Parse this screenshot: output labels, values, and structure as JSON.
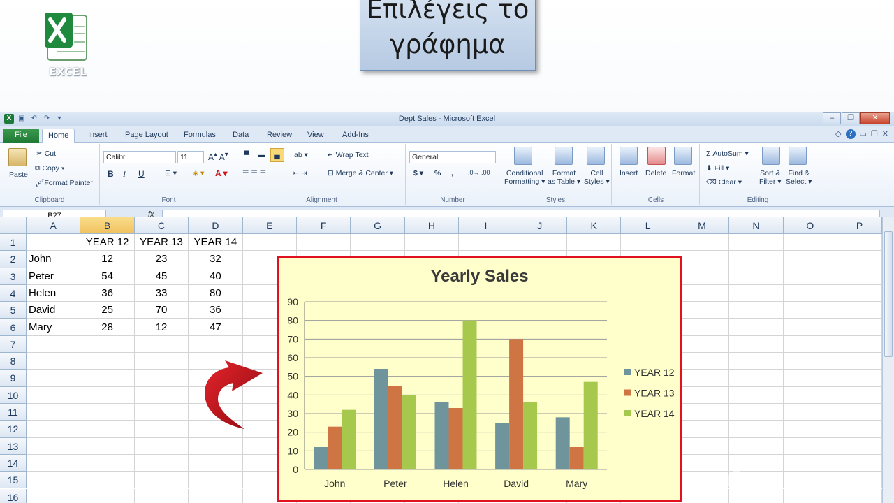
{
  "slide": {
    "callout_line1": "Επιλέγεις το",
    "callout_line2": "γράφημα",
    "logo_label": "EXCEL"
  },
  "window": {
    "title": "Dept Sales  -  Microsoft Excel"
  },
  "tabs": [
    "File",
    "Home",
    "Insert",
    "Page Layout",
    "Formulas",
    "Data",
    "Review",
    "View",
    "Add-Ins"
  ],
  "ribbon": {
    "clipboard": {
      "paste": "Paste",
      "cut": "Cut",
      "copy": "Copy",
      "format_painter": "Format Painter",
      "label": "Clipboard"
    },
    "font": {
      "name": "Calibri",
      "size": "11",
      "bold": "B",
      "italic": "I",
      "underline": "U",
      "label": "Font"
    },
    "alignment": {
      "wrap": "Wrap Text",
      "merge": "Merge & Center",
      "label": "Alignment"
    },
    "number": {
      "format": "General",
      "currency": "$",
      "percent": "%",
      "comma": ",",
      "label": "Number"
    },
    "styles": {
      "conditional": "Conditional",
      "conditional2": "Formatting",
      "format_table": "Format",
      "format_table2": "as Table",
      "cell_styles": "Cell",
      "cell_styles2": "Styles",
      "label": "Styles"
    },
    "cells": {
      "insert": "Insert",
      "delete": "Delete",
      "format": "Format",
      "label": "Cells"
    },
    "editing": {
      "autosum": "AutoSum",
      "fill": "Fill",
      "clear": "Clear",
      "sort": "Sort &",
      "sort2": "Filter",
      "find": "Find &",
      "find2": "Select",
      "label": "Editing"
    }
  },
  "formula_bar": {
    "name_box": "B27",
    "fx": "fx",
    "value": ""
  },
  "sheet": {
    "columns": [
      "A",
      "B",
      "C",
      "D",
      "E",
      "F",
      "G",
      "H",
      "I",
      "J",
      "K",
      "L",
      "M",
      "N",
      "O",
      "P"
    ],
    "selected_column": "B",
    "rows": [
      "1",
      "2",
      "3",
      "4",
      "5",
      "6",
      "7",
      "8",
      "9",
      "10",
      "11",
      "12",
      "13",
      "14",
      "15",
      "16"
    ],
    "headers": [
      "YEAR 12",
      "YEAR 13",
      "YEAR 14"
    ],
    "data": [
      [
        "John",
        "12",
        "23",
        "32"
      ],
      [
        "Peter",
        "54",
        "45",
        "40"
      ],
      [
        "Helen",
        "36",
        "33",
        "80"
      ],
      [
        "David",
        "25",
        "70",
        "36"
      ],
      [
        "Mary",
        "28",
        "12",
        "47"
      ]
    ]
  },
  "chart_data": {
    "type": "bar",
    "title": "Yearly Sales",
    "categories": [
      "John",
      "Peter",
      "Helen",
      "David",
      "Mary"
    ],
    "series": [
      {
        "name": "YEAR 12",
        "values": [
          12,
          54,
          36,
          25,
          28
        ],
        "color": "#6f949b"
      },
      {
        "name": "YEAR 13",
        "values": [
          23,
          45,
          33,
          70,
          12
        ],
        "color": "#cf7543"
      },
      {
        "name": "YEAR 14",
        "values": [
          32,
          40,
          80,
          36,
          47
        ],
        "color": "#a6c84d"
      }
    ],
    "ylim": [
      0,
      90
    ],
    "yticks": [
      0,
      10,
      20,
      30,
      40,
      50,
      60,
      70,
      80,
      90
    ],
    "grid": true,
    "legend": "right",
    "xlabel": "",
    "ylabel": ""
  },
  "colors": {
    "chart_bg": "#ffffcc",
    "chart_border": "#e0121f",
    "arrow": "#c0101a",
    "selected_header": "#f1c15f"
  }
}
